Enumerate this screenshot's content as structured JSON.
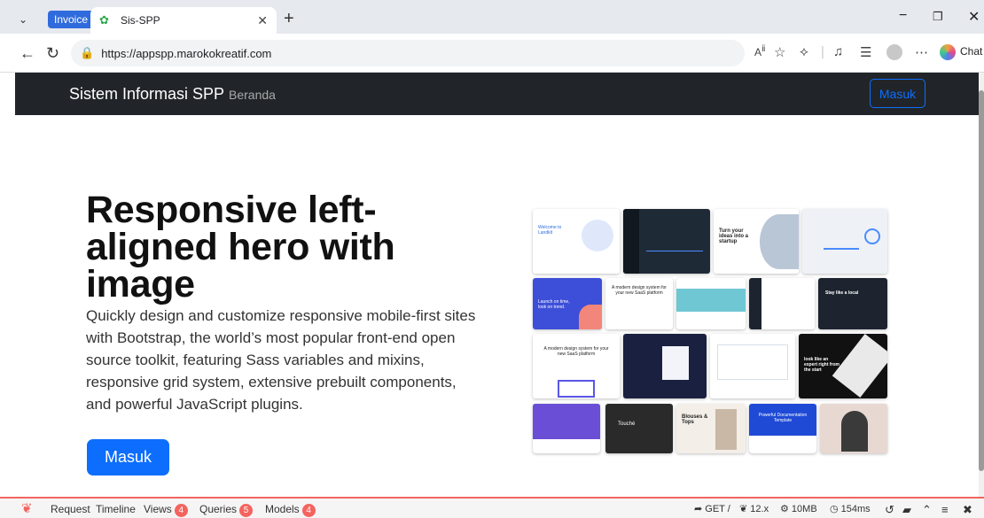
{
  "browser": {
    "tab_group": "Invoice",
    "tab_title": "Sis-SPP",
    "url": "https://appspp.marokokreatif.com",
    "chat_label": "Chat"
  },
  "navbar": {
    "brand": "Sistem Informasi SPP",
    "link_home": "Beranda",
    "login_button": "Masuk"
  },
  "hero": {
    "title": "Responsive left-aligned hero with image",
    "lead": "Quickly design and customize responsive mobile-first sites with Bootstrap, the world’s most popular front-end open source toolkit, featuring Sass variables and mixins, responsive grid system, extensive prebuilt components, and powerful JavaScript plugins.",
    "button": "Masuk"
  },
  "mosaic": {
    "colors": [
      "#ffffff",
      "#1f2a37",
      "#ffffff",
      "#eef2f7",
      "#3d4fd8",
      "#ffffff",
      "#ffffff",
      "#ffffff",
      "#1d2430",
      "#ffffff",
      "#1a2140",
      "#ffffff",
      "#111111",
      "#6a4fd6",
      "#2a2a2a",
      "#f3efe8",
      "#1f4ad6",
      "#e7d8d2"
    ],
    "texts": {
      "t1": "Welcome to Landkit",
      "t3": "Turn your ideas into a startup",
      "t5": "Launch on time, look on trend.",
      "t6": "A modern design system for your new SaaS platform",
      "t9": "Stay like a local",
      "t10": "A modern design system for your new SaaS platform",
      "t13": "look like an expert right from the start",
      "t15": "Touché",
      "t16": "Blouses & Tops",
      "t17": "Powerful Documentation Template"
    }
  },
  "debugbar": {
    "request": "Request",
    "timeline": "Timeline",
    "views": "Views",
    "views_count": "4",
    "queries": "Queries",
    "queries_count": "5",
    "models": "Models",
    "models_count": "4",
    "method": "GET /",
    "version": "12.x",
    "memory": "10MB",
    "time": "154ms"
  }
}
